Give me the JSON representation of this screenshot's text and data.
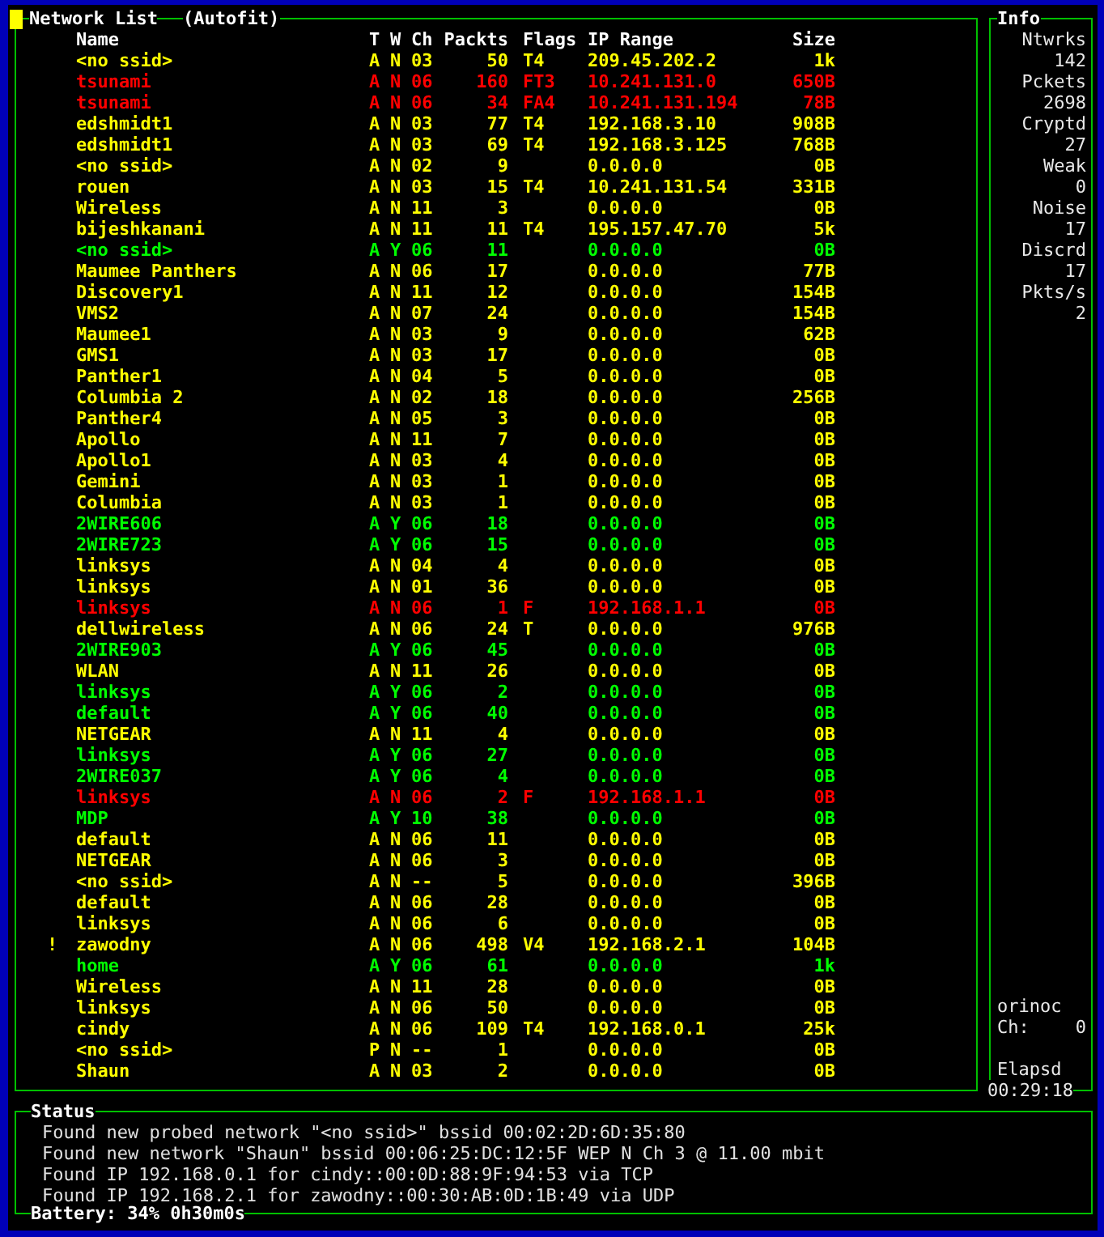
{
  "network_list": {
    "title": "Network List",
    "mode": "(Autofit)",
    "columns": {
      "name": "Name",
      "type": "T",
      "wep": "W",
      "channel": "Ch",
      "packets": "Packts",
      "flags": "Flags",
      "ip_range": "IP Range",
      "size": "Size"
    },
    "rows": [
      {
        "name": "<no ssid>",
        "type": "A",
        "wep": "N",
        "channel": "03",
        "packets": "50",
        "flags": "T4",
        "ip_range": "209.45.202.2",
        "size": "1k",
        "color": "#ffff00"
      },
      {
        "name": "tsunami",
        "type": "A",
        "wep": "N",
        "channel": "06",
        "packets": "160",
        "flags": "FT3",
        "ip_range": "10.241.131.0",
        "size": "650B",
        "color": "#ff0000"
      },
      {
        "name": "tsunami",
        "type": "A",
        "wep": "N",
        "channel": "06",
        "packets": "34",
        "flags": "FA4",
        "ip_range": "10.241.131.194",
        "size": "78B",
        "color": "#ff0000"
      },
      {
        "name": "edshmidt1",
        "type": "A",
        "wep": "N",
        "channel": "03",
        "packets": "77",
        "flags": "T4",
        "ip_range": "192.168.3.10",
        "size": "908B",
        "color": "#ffff00"
      },
      {
        "name": "edshmidt1",
        "type": "A",
        "wep": "N",
        "channel": "03",
        "packets": "69",
        "flags": "T4",
        "ip_range": "192.168.3.125",
        "size": "768B",
        "color": "#ffff00"
      },
      {
        "name": "<no ssid>",
        "type": "A",
        "wep": "N",
        "channel": "02",
        "packets": "9",
        "ip_range": "0.0.0.0",
        "size": "0B",
        "color": "#ffff00"
      },
      {
        "name": "rouen",
        "type": "A",
        "wep": "N",
        "channel": "03",
        "packets": "15",
        "flags": "T4",
        "ip_range": "10.241.131.54",
        "size": "331B",
        "color": "#ffff00"
      },
      {
        "name": "Wireless",
        "type": "A",
        "wep": "N",
        "channel": "11",
        "packets": "3",
        "ip_range": "0.0.0.0",
        "size": "0B",
        "color": "#ffff00"
      },
      {
        "name": "bijeshkanani",
        "type": "A",
        "wep": "N",
        "channel": "11",
        "packets": "11",
        "flags": "T4",
        "ip_range": "195.157.47.70",
        "size": "5k",
        "color": "#ffff00"
      },
      {
        "name": "<no ssid>",
        "type": "A",
        "wep": "Y",
        "channel": "06",
        "packets": "11",
        "ip_range": "0.0.0.0",
        "size": "0B",
        "color": "#00ff00"
      },
      {
        "name": "Maumee Panthers",
        "type": "A",
        "wep": "N",
        "channel": "06",
        "packets": "17",
        "ip_range": "0.0.0.0",
        "size": "77B",
        "color": "#ffff00"
      },
      {
        "name": "Discovery1",
        "type": "A",
        "wep": "N",
        "channel": "11",
        "packets": "12",
        "ip_range": "0.0.0.0",
        "size": "154B",
        "color": "#ffff00"
      },
      {
        "name": "VMS2",
        "type": "A",
        "wep": "N",
        "channel": "07",
        "packets": "24",
        "ip_range": "0.0.0.0",
        "size": "154B",
        "color": "#ffff00"
      },
      {
        "name": "Maumee1",
        "type": "A",
        "wep": "N",
        "channel": "03",
        "packets": "9",
        "ip_range": "0.0.0.0",
        "size": "62B",
        "color": "#ffff00"
      },
      {
        "name": "GMS1",
        "type": "A",
        "wep": "N",
        "channel": "03",
        "packets": "17",
        "ip_range": "0.0.0.0",
        "size": "0B",
        "color": "#ffff00"
      },
      {
        "name": "Panther1",
        "type": "A",
        "wep": "N",
        "channel": "04",
        "packets": "5",
        "ip_range": "0.0.0.0",
        "size": "0B",
        "color": "#ffff00"
      },
      {
        "name": "Columbia 2",
        "type": "A",
        "wep": "N",
        "channel": "02",
        "packets": "18",
        "ip_range": "0.0.0.0",
        "size": "256B",
        "color": "#ffff00"
      },
      {
        "name": "Panther4",
        "type": "A",
        "wep": "N",
        "channel": "05",
        "packets": "3",
        "ip_range": "0.0.0.0",
        "size": "0B",
        "color": "#ffff00"
      },
      {
        "name": "Apollo",
        "type": "A",
        "wep": "N",
        "channel": "11",
        "packets": "7",
        "ip_range": "0.0.0.0",
        "size": "0B",
        "color": "#ffff00"
      },
      {
        "name": "Apollo1",
        "type": "A",
        "wep": "N",
        "channel": "03",
        "packets": "4",
        "ip_range": "0.0.0.0",
        "size": "0B",
        "color": "#ffff00"
      },
      {
        "name": "Gemini",
        "type": "A",
        "wep": "N",
        "channel": "03",
        "packets": "1",
        "ip_range": "0.0.0.0",
        "size": "0B",
        "color": "#ffff00"
      },
      {
        "name": "Columbia",
        "type": "A",
        "wep": "N",
        "channel": "03",
        "packets": "1",
        "ip_range": "0.0.0.0",
        "size": "0B",
        "color": "#ffff00"
      },
      {
        "name": "2WIRE606",
        "type": "A",
        "wep": "Y",
        "channel": "06",
        "packets": "18",
        "ip_range": "0.0.0.0",
        "size": "0B",
        "color": "#00ff00"
      },
      {
        "name": "2WIRE723",
        "type": "A",
        "wep": "Y",
        "channel": "06",
        "packets": "15",
        "ip_range": "0.0.0.0",
        "size": "0B",
        "color": "#00ff00"
      },
      {
        "name": "linksys",
        "type": "A",
        "wep": "N",
        "channel": "04",
        "packets": "4",
        "ip_range": "0.0.0.0",
        "size": "0B",
        "color": "#ffff00"
      },
      {
        "name": "linksys",
        "type": "A",
        "wep": "N",
        "channel": "01",
        "packets": "36",
        "ip_range": "0.0.0.0",
        "size": "0B",
        "color": "#ffff00"
      },
      {
        "name": "linksys",
        "type": "A",
        "wep": "N",
        "channel": "06",
        "packets": "1",
        "flags": "F",
        "ip_range": "192.168.1.1",
        "size": "0B",
        "color": "#ff0000"
      },
      {
        "name": "dellwireless",
        "type": "A",
        "wep": "N",
        "channel": "06",
        "packets": "24",
        "flags": "T",
        "ip_range": "0.0.0.0",
        "size": "976B",
        "color": "#ffff00"
      },
      {
        "name": "2WIRE903",
        "type": "A",
        "wep": "Y",
        "channel": "06",
        "packets": "45",
        "ip_range": "0.0.0.0",
        "size": "0B",
        "color": "#00ff00"
      },
      {
        "name": "WLAN",
        "type": "A",
        "wep": "N",
        "channel": "11",
        "packets": "26",
        "ip_range": "0.0.0.0",
        "size": "0B",
        "color": "#ffff00"
      },
      {
        "name": "linksys",
        "type": "A",
        "wep": "Y",
        "channel": "06",
        "packets": "2",
        "ip_range": "0.0.0.0",
        "size": "0B",
        "color": "#00ff00"
      },
      {
        "name": "default",
        "type": "A",
        "wep": "Y",
        "channel": "06",
        "packets": "40",
        "ip_range": "0.0.0.0",
        "size": "0B",
        "color": "#00ff00"
      },
      {
        "name": "NETGEAR",
        "type": "A",
        "wep": "N",
        "channel": "11",
        "packets": "4",
        "ip_range": "0.0.0.0",
        "size": "0B",
        "color": "#ffff00"
      },
      {
        "name": "linksys",
        "type": "A",
        "wep": "Y",
        "channel": "06",
        "packets": "27",
        "ip_range": "0.0.0.0",
        "size": "0B",
        "color": "#00ff00"
      },
      {
        "name": "2WIRE037",
        "type": "A",
        "wep": "Y",
        "channel": "06",
        "packets": "4",
        "ip_range": "0.0.0.0",
        "size": "0B",
        "color": "#00ff00"
      },
      {
        "name": "linksys",
        "type": "A",
        "wep": "N",
        "channel": "06",
        "packets": "2",
        "flags": "F",
        "ip_range": "192.168.1.1",
        "size": "0B",
        "color": "#ff0000"
      },
      {
        "name": "MDP",
        "type": "A",
        "wep": "Y",
        "channel": "10",
        "packets": "38",
        "ip_range": "0.0.0.0",
        "size": "0B",
        "color": "#00ff00"
      },
      {
        "name": "default",
        "type": "A",
        "wep": "N",
        "channel": "06",
        "packets": "11",
        "ip_range": "0.0.0.0",
        "size": "0B",
        "color": "#ffff00"
      },
      {
        "name": "NETGEAR",
        "type": "A",
        "wep": "N",
        "channel": "06",
        "packets": "3",
        "ip_range": "0.0.0.0",
        "size": "0B",
        "color": "#ffff00"
      },
      {
        "name": "<no ssid>",
        "type": "A",
        "wep": "N",
        "channel": "--",
        "packets": "5",
        "ip_range": "0.0.0.0",
        "size": "396B",
        "color": "#ffff00"
      },
      {
        "name": "default",
        "type": "A",
        "wep": "N",
        "channel": "06",
        "packets": "28",
        "ip_range": "0.0.0.0",
        "size": "0B",
        "color": "#ffff00"
      },
      {
        "name": "linksys",
        "type": "A",
        "wep": "N",
        "channel": "06",
        "packets": "6",
        "ip_range": "0.0.0.0",
        "size": "0B",
        "color": "#ffff00"
      },
      {
        "mark": "!",
        "name": "zawodny",
        "type": "A",
        "wep": "N",
        "channel": "06",
        "packets": "498",
        "flags": "V4",
        "ip_range": "192.168.2.1",
        "size": "104B",
        "color": "#ffff00"
      },
      {
        "name": "home",
        "type": "A",
        "wep": "Y",
        "channel": "06",
        "packets": "61",
        "ip_range": "0.0.0.0",
        "size": "1k",
        "color": "#00ff00"
      },
      {
        "name": "Wireless",
        "type": "A",
        "wep": "N",
        "channel": "11",
        "packets": "28",
        "ip_range": "0.0.0.0",
        "size": "0B",
        "color": "#ffff00"
      },
      {
        "name": "linksys",
        "type": "A",
        "wep": "N",
        "channel": "06",
        "packets": "50",
        "ip_range": "0.0.0.0",
        "size": "0B",
        "color": "#ffff00"
      },
      {
        "name": "cindy",
        "type": "A",
        "wep": "N",
        "channel": "06",
        "packets": "109",
        "flags": "T4",
        "ip_range": "192.168.0.1",
        "size": "25k",
        "color": "#ffff00"
      },
      {
        "name": "<no ssid>",
        "type": "P",
        "wep": "N",
        "channel": "--",
        "packets": "1",
        "ip_range": "0.0.0.0",
        "size": "0B",
        "color": "#ffff00"
      },
      {
        "name": "Shaun",
        "type": "A",
        "wep": "N",
        "channel": "03",
        "packets": "2",
        "ip_range": "0.0.0.0",
        "size": "0B",
        "color": "#ffff00"
      }
    ]
  },
  "info": {
    "title": "Info",
    "stats": [
      {
        "label": "Ntwrks",
        "value": "142"
      },
      {
        "label": "Pckets",
        "value": "2698"
      },
      {
        "label": "Cryptd",
        "value": "27"
      },
      {
        "label": "Weak",
        "value": "0"
      },
      {
        "label": "Noise",
        "value": "17"
      },
      {
        "label": "Discrd",
        "value": "17"
      },
      {
        "label": "Pkts/s",
        "value": "2"
      }
    ],
    "card": "orinoc",
    "channel": {
      "label": "Ch:",
      "value": "0"
    },
    "elapsed": {
      "label": "Elapsd",
      "value": "00:29:18"
    }
  },
  "status": {
    "title": "Status",
    "lines": [
      "Found new probed network \"<no ssid>\" bssid 00:02:2D:6D:35:80",
      "Found new network \"Shaun\" bssid 00:06:25:DC:12:5F WEP N Ch 3 @ 11.00 mbit",
      "Found IP 192.168.0.1 for cindy::00:0D:88:9F:94:53 via TCP",
      "Found IP 192.168.2.1 for zawodny::00:30:AB:0D:1B:49 via UDP"
    ],
    "battery": "Battery: 34% 0h30m0s"
  }
}
